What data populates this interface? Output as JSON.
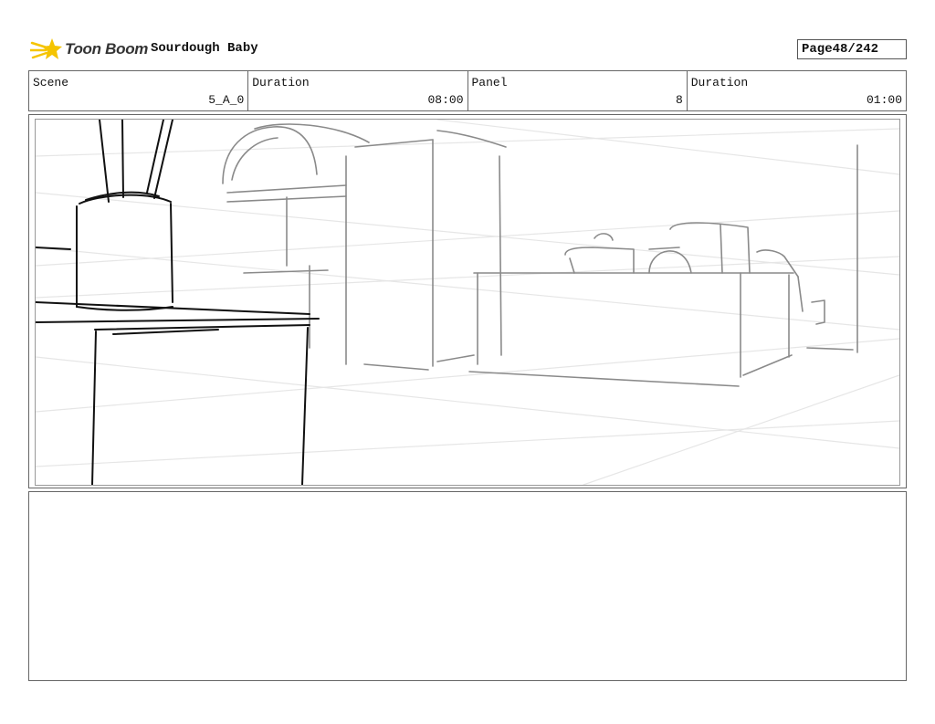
{
  "header": {
    "logo_text": "Toon Boom",
    "logo_icon": "comet-star-icon",
    "project_title": "Sourdough Baby",
    "page_label": "Page",
    "page_value": "48/242"
  },
  "info": {
    "scene_label": "Scene",
    "scene_value": "5_A_0",
    "scene_duration_label": "Duration",
    "scene_duration_value": "08:00",
    "panel_label": "Panel",
    "panel_value": "8",
    "panel_duration_label": "Duration",
    "panel_duration_value": "01:00"
  },
  "colors": {
    "sketch_dark": "#111111",
    "sketch_grey": "#8a8a8a",
    "guide_lines": "#e4e4e4",
    "logo_yellow": "#f5c400",
    "border": "#666666"
  },
  "notes": {
    "text": ""
  }
}
